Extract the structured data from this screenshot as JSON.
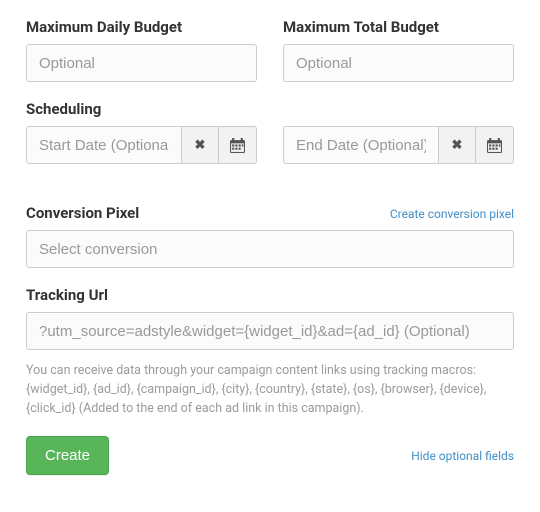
{
  "budget": {
    "daily": {
      "label": "Maximum Daily Budget",
      "placeholder": "Optional"
    },
    "total": {
      "label": "Maximum Total Budget",
      "placeholder": "Optional"
    }
  },
  "scheduling": {
    "label": "Scheduling",
    "start_placeholder": "Start Date (Optional)",
    "end_placeholder": "End Date (Optional)"
  },
  "conversion": {
    "label": "Conversion Pixel",
    "create_link": "Create conversion pixel",
    "placeholder": "Select conversion"
  },
  "tracking": {
    "label": "Tracking Url",
    "placeholder": "?utm_source=adstyle&widget={widget_id}&ad={ad_id} (Optional)",
    "help": "You can receive data through your campaign content links using tracking macros: {widget_id}, {ad_id}, {campaign_id}, {city}, {country}, {state}, {os}, {browser}, {device}, {click_id} (Added to the end of each ad link in this campaign)."
  },
  "footer": {
    "create": "Create",
    "hide_optional": "Hide optional fields"
  }
}
